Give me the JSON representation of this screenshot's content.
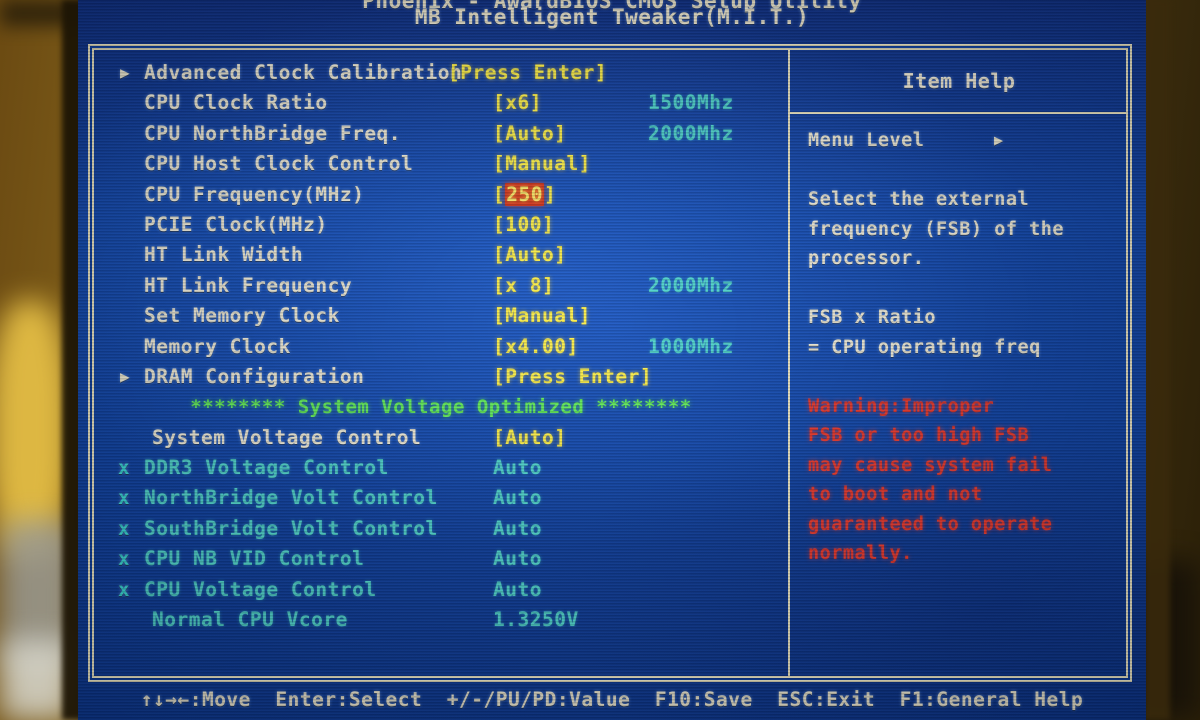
{
  "window": {
    "title_partial": "Phoenix - AwardBIOS CMOS Setup Utility",
    "subtitle": "MB Intelligent Tweaker(M.I.T.)"
  },
  "menu": {
    "rows": [
      {
        "kind": "submenu",
        "prefix": "▶",
        "label": "Advanced Clock Calibration",
        "value": "[Press Enter]",
        "freq": "",
        "inline": true
      },
      {
        "kind": "setting",
        "prefix": "",
        "label": "CPU Clock Ratio",
        "value": "[x6]",
        "freq": "1500Mhz"
      },
      {
        "kind": "setting",
        "prefix": "",
        "label": "CPU NorthBridge Freq.",
        "value": "[Auto]",
        "freq": "2000Mhz"
      },
      {
        "kind": "setting",
        "prefix": "",
        "label": "CPU Host Clock Control",
        "value": "[Manual]",
        "freq": ""
      },
      {
        "kind": "selected",
        "prefix": "",
        "label": "CPU Frequency(MHz)",
        "value": "250",
        "freq": ""
      },
      {
        "kind": "setting",
        "prefix": "",
        "label": "PCIE Clock(MHz)",
        "value": "[100]",
        "freq": ""
      },
      {
        "kind": "setting",
        "prefix": "",
        "label": "HT Link Width",
        "value": "[Auto]",
        "freq": ""
      },
      {
        "kind": "setting",
        "prefix": "",
        "label": "HT Link Frequency",
        "value": "[x 8]",
        "freq": "2000Mhz"
      },
      {
        "kind": "setting",
        "prefix": "",
        "label": "Set Memory Clock",
        "value": "[Manual]",
        "freq": ""
      },
      {
        "kind": "setting",
        "prefix": "",
        "label": "Memory Clock",
        "value": "[x4.00]",
        "freq": "1000Mhz"
      },
      {
        "kind": "submenu",
        "prefix": "▶",
        "label": "DRAM Configuration",
        "value": "[Press Enter]",
        "freq": ""
      },
      {
        "kind": "banner",
        "prefix": "",
        "label": "******** System Voltage Optimized ********",
        "value": "",
        "freq": ""
      },
      {
        "kind": "setting",
        "prefix": "",
        "label": "System Voltage Control",
        "value": "[Auto]",
        "freq": ""
      },
      {
        "kind": "disabled",
        "prefix": "x",
        "label": "DDR3 Voltage Control",
        "value": "Auto",
        "freq": ""
      },
      {
        "kind": "disabled",
        "prefix": "x",
        "label": "NorthBridge Volt Control",
        "value": "Auto",
        "freq": ""
      },
      {
        "kind": "disabled",
        "prefix": "x",
        "label": "SouthBridge Volt Control",
        "value": "Auto",
        "freq": ""
      },
      {
        "kind": "disabled",
        "prefix": "x",
        "label": "CPU NB VID Control",
        "value": "Auto",
        "freq": ""
      },
      {
        "kind": "disabled",
        "prefix": "x",
        "label": "CPU Voltage Control",
        "value": "Auto",
        "freq": ""
      },
      {
        "kind": "readonly",
        "prefix": "",
        "label": "Normal CPU Vcore",
        "value": "1.3250V",
        "freq": ""
      }
    ]
  },
  "help": {
    "title": "Item Help",
    "menu_level_label": "Menu Level",
    "menu_level_arrow": "▶",
    "description_lines": [
      "Select the external",
      "frequency (FSB) of the",
      "processor."
    ],
    "formula_lines": [
      "FSB x Ratio",
      "= CPU operating freq"
    ],
    "warning_lines": [
      "Warning:Improper",
      "FSB or too high FSB",
      "may cause system fail",
      "to boot and not",
      "guaranteed to operate",
      "normally."
    ]
  },
  "hintbar": {
    "text": "↑↓→←:Move  Enter:Select  +/-/PU/PD:Value  F10:Save  ESC:Exit  F1:General Help"
  },
  "colors": {
    "screen_blue": "#0d42a6",
    "border": "#efe9c6",
    "label_white": "#f2eedb",
    "value_yellow": "#fff24a",
    "freq_cyan": "#3fe3e0",
    "banner_green": "#63f05b",
    "disabled_cyan": "#4fd6cf",
    "warning_red": "#e8372c",
    "highlight_bg": "#d8361f",
    "highlight_fg": "#ffe96b"
  }
}
